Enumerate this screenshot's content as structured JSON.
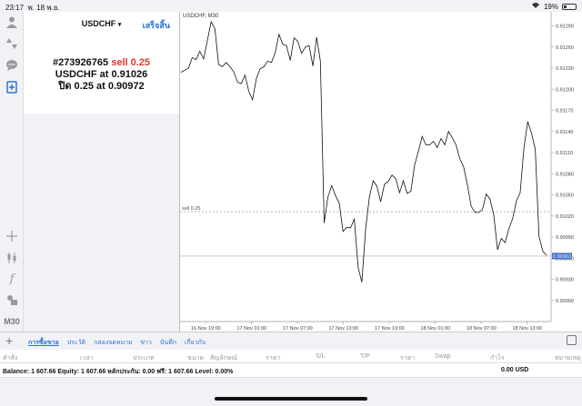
{
  "status": {
    "time": "23:17",
    "date": "พ. 18 พ.ย.",
    "battery": "19%"
  },
  "toolbar": {
    "icons": [
      "account-icon",
      "quotes-icon",
      "chat-icon",
      "new-order-icon",
      "crosshair-icon",
      "candles-icon",
      "function-icon",
      "objects-icon"
    ],
    "timeframe": "M30"
  },
  "panel": {
    "symbol": "USDCHF",
    "dropdown": "▾",
    "done": "เสร็จสิ้น",
    "ticket": "#273926765",
    "action": "sell 0.25",
    "line2_prefix": "USDCHF at ",
    "line2_value": "0.91026",
    "line3_prefix": "ปิด 0.25 at ",
    "line3_value": "0.90972"
  },
  "chart_data": {
    "type": "line",
    "title": "USDCHF, M30",
    "ylim": [
      0.9087,
      0.9131
    ],
    "ytick_labels": [
      "0.91290",
      "0.91260",
      "0.91230",
      "0.91200",
      "0.91170",
      "0.91140",
      "0.91110",
      "0.91080",
      "0.91050",
      "0.91020",
      "0.90990",
      "0.90960",
      "0.90930",
      "0.90900"
    ],
    "xtick_labels": [
      "16 Nov 19:00",
      "17 Nov 01:00",
      "17 Nov 07:00",
      "17 Nov 13:00",
      "17 Nov 19:00",
      "18 Nov 01:00",
      "18 Nov 07:00",
      "18 Nov 13:00"
    ],
    "sell_line": {
      "label": "sell 0.25",
      "value": 0.91026
    },
    "current_price": {
      "label": "0.90963",
      "value": 0.90963
    },
    "series": [
      {
        "values": [
          0.91224,
          0.91227,
          0.9123,
          0.91245,
          0.91242,
          0.91254,
          0.91243,
          0.91269,
          0.91296,
          0.91286,
          0.91235,
          0.91232,
          0.91238,
          0.91232,
          0.91225,
          0.9121,
          0.91208,
          0.9122,
          0.91197,
          0.91185,
          0.91215,
          0.91229,
          0.91232,
          0.9124,
          0.91238,
          0.91252,
          0.91278,
          0.91264,
          0.91262,
          0.91241,
          0.91273,
          0.91268,
          0.91251,
          0.9126,
          0.91262,
          0.91233,
          0.91274,
          0.9124,
          0.9101,
          0.91047,
          0.91063,
          0.91049,
          0.91038,
          0.90998,
          0.91004,
          0.91003,
          0.91016,
          0.90947,
          0.90926,
          0.91002,
          0.91047,
          0.9107,
          0.91062,
          0.9104,
          0.91065,
          0.91069,
          0.91078,
          0.91073,
          0.91053,
          0.9107,
          0.91052,
          0.91055,
          0.91092,
          0.91112,
          0.91133,
          0.91121,
          0.91121,
          0.91126,
          0.91117,
          0.9113,
          0.91121,
          0.9114,
          0.91131,
          0.91121,
          0.91101,
          0.9109,
          0.91064,
          0.91034,
          0.91025,
          0.91025,
          0.91029,
          0.91051,
          0.91044,
          0.91021,
          0.90972,
          0.90988,
          0.90982,
          0.91002,
          0.91016,
          0.91041,
          0.91053,
          0.91116,
          0.91154,
          0.91138,
          0.91115,
          0.90991,
          0.9097,
          0.90964
        ]
      }
    ]
  },
  "tabs": {
    "items": [
      "การซื้อขาย",
      "ประวัติ",
      "กล่องจดหมาย",
      "ข่าว",
      "บันทึก",
      "เกี่ยวกับ"
    ]
  },
  "columns": [
    "คำสั่ง",
    "เวลา",
    "ประเภท",
    "ขนาด",
    "สัญลักษณ์",
    "ราคา",
    "S/L",
    "T/P",
    "ราคา",
    "Swap",
    "กำไร",
    "หมายเหตุ"
  ],
  "balance": {
    "text": "Balance: 1 607.66 Equity: 1 607.66 หลักประกัน: 0.00 ฟรี: 1 607.66 Level: 0.00%",
    "profit": "0.00  USD"
  },
  "colors": {
    "accent": "#2a74d8",
    "sell": "#e0362f",
    "price_tag": "#3f6ec9"
  }
}
